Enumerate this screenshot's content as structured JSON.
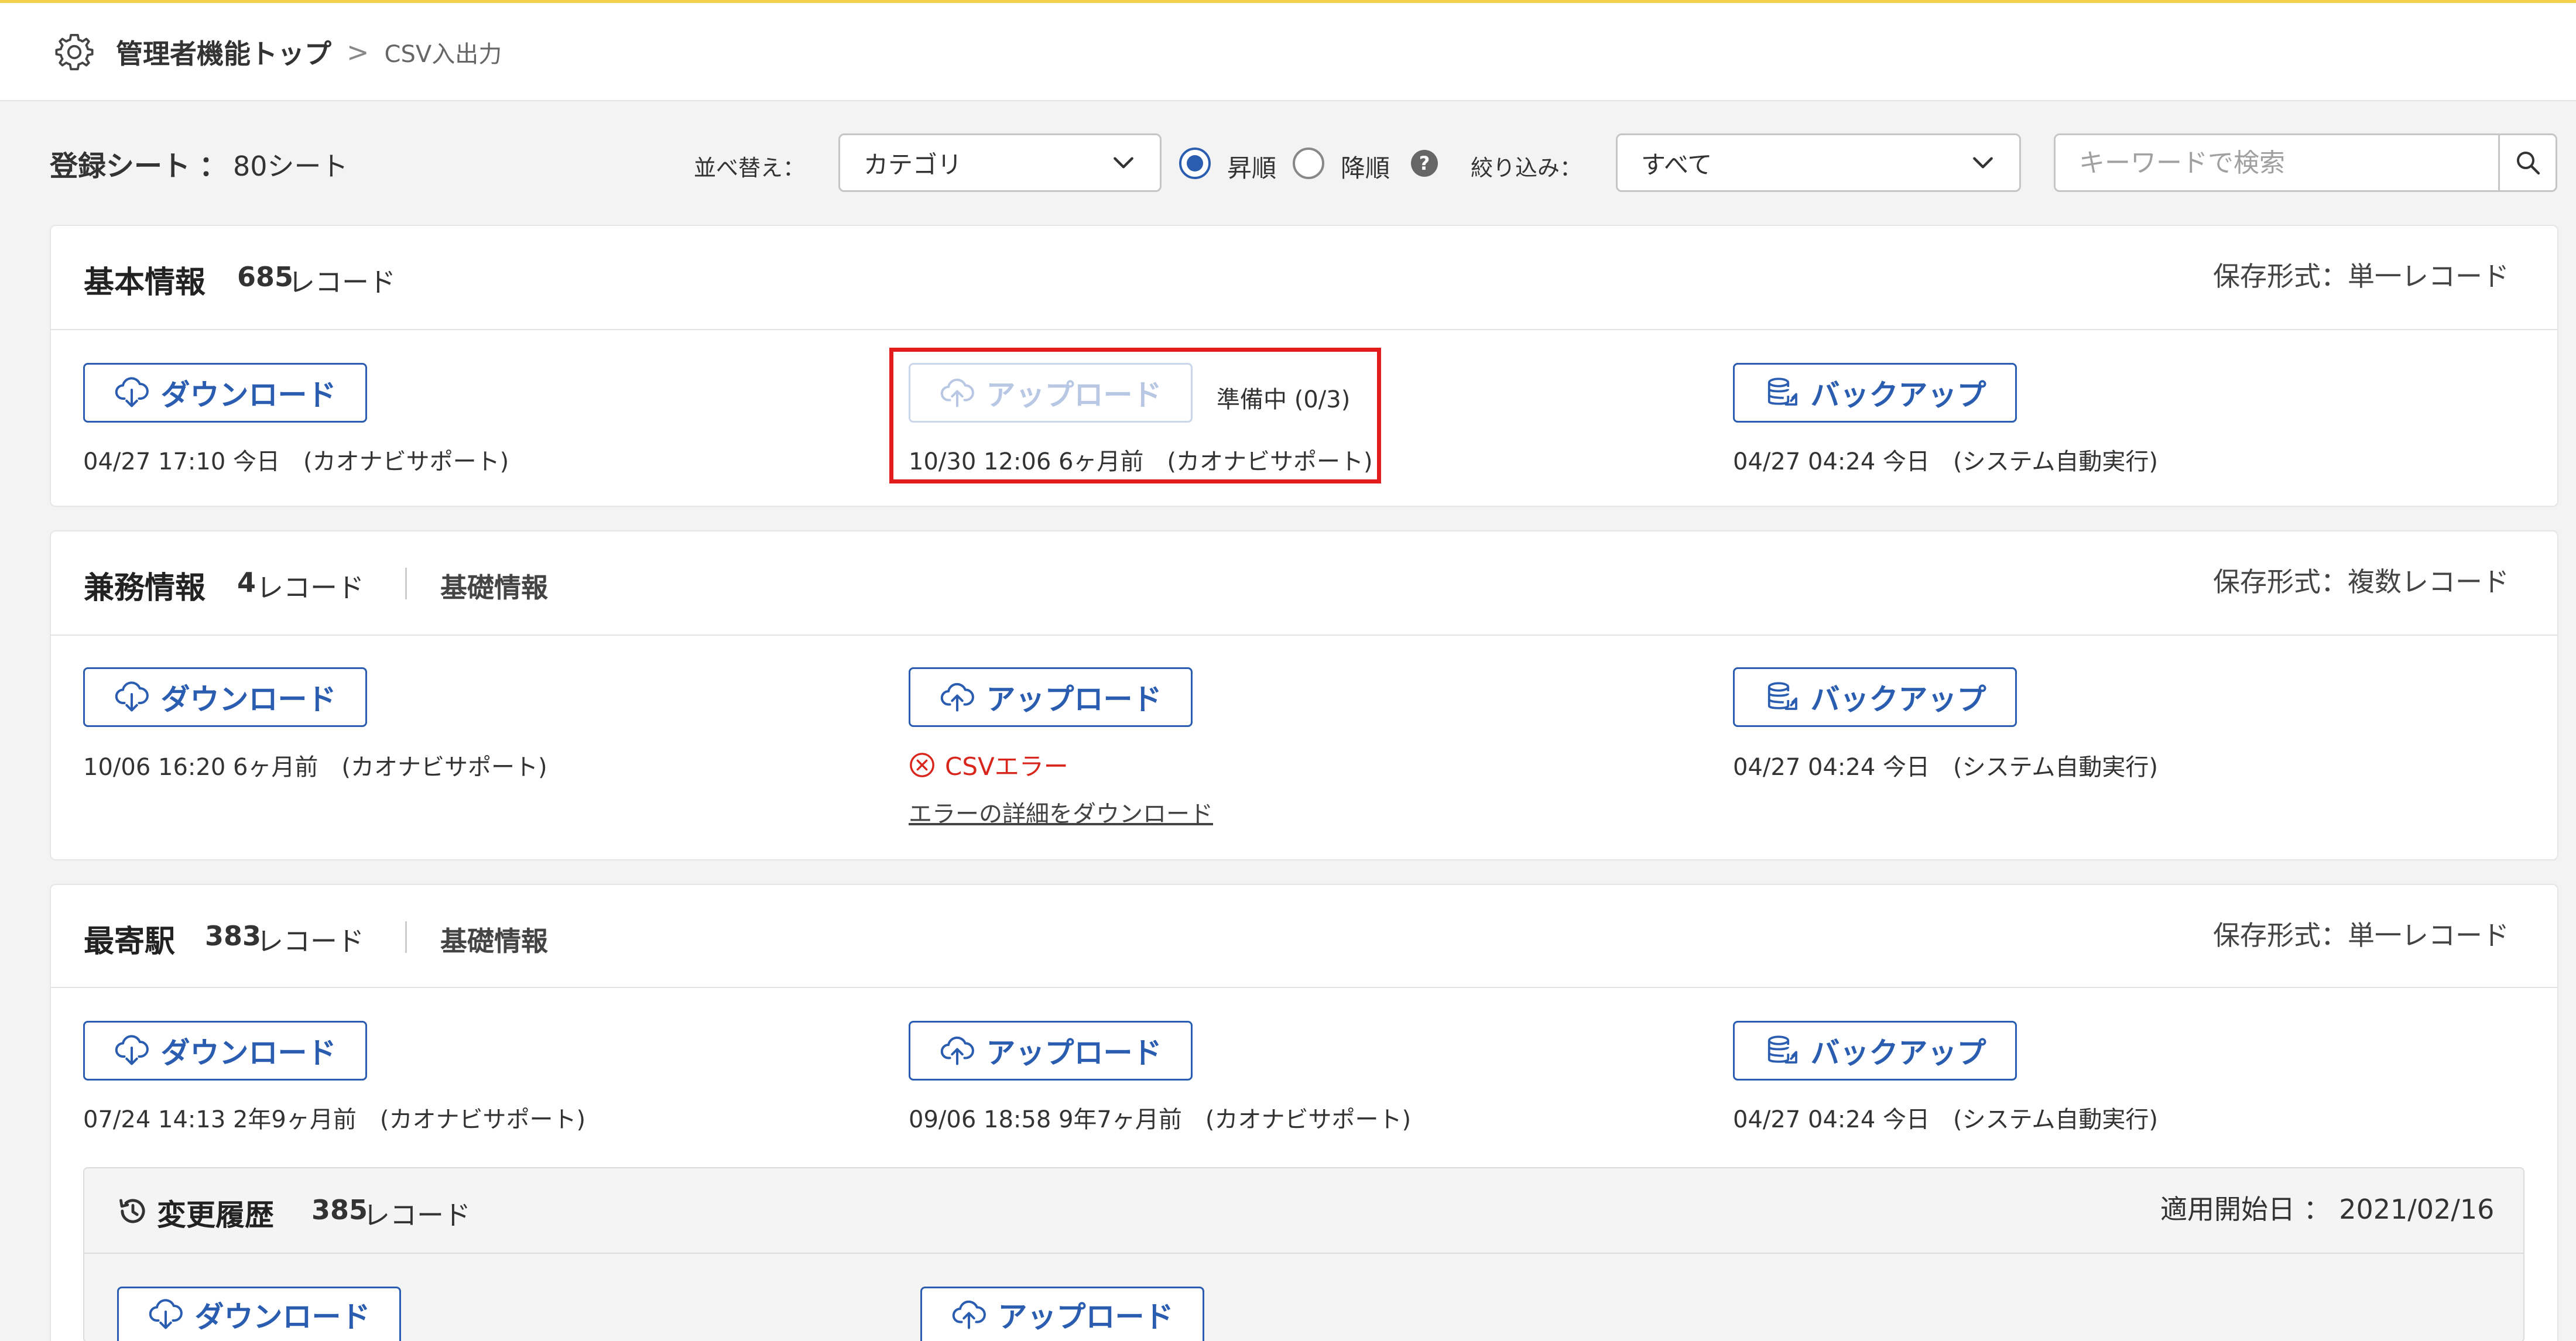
{
  "header": {
    "title": "管理者機能トップ",
    "separator": ">",
    "current": "CSV入出力",
    "icon": "gear-icon"
  },
  "toolbar": {
    "sheets_label": "登録シート",
    "sheets_colon": "：",
    "sheets_count": "80シート",
    "sort_label": "並べ替え：",
    "sort_value": "カテゴリ",
    "asc_label": "昇順",
    "desc_label": "降順",
    "help": "?",
    "filter_label": "絞り込み：",
    "filter_value": "すべて",
    "search_placeholder": "キーワードで検索"
  },
  "cards": [
    {
      "title": "基本情報",
      "count": "685",
      "unit": "レコード",
      "category": "",
      "format": "保存形式：単一レコード",
      "download": {
        "label": "ダウンロード",
        "meta": "04/27 17:10 今日　(カオナビサポート)"
      },
      "upload": {
        "label": "アップロード",
        "status": "準備中 (0/3)",
        "meta": "10/30 12:06 6ヶ月前　(カオナビサポート)",
        "disabled": true
      },
      "backup": {
        "label": "バックアップ",
        "meta": "04/27 04:24 今日　(システム自動実行)"
      }
    },
    {
      "title": "兼務情報",
      "count": "4",
      "unit": "レコード",
      "category": "基礎情報",
      "format": "保存形式：複数レコード",
      "download": {
        "label": "ダウンロード",
        "meta": "10/06 16:20 6ヶ月前　(カオナビサポート)"
      },
      "upload": {
        "label": "アップロード",
        "error": "CSVエラー",
        "error_link": "エラーの詳細をダウンロード"
      },
      "backup": {
        "label": "バックアップ",
        "meta": "04/27 04:24 今日　(システム自動実行)"
      }
    },
    {
      "title": "最寄駅",
      "count": "383",
      "unit": "レコード",
      "category": "基礎情報",
      "format": "保存形式：単一レコード",
      "download": {
        "label": "ダウンロード",
        "meta": "07/24 14:13 2年9ヶ月前　(カオナビサポート)"
      },
      "upload": {
        "label": "アップロード",
        "meta": "09/06 18:58 9年7ヶ月前　(カオナビサポート)"
      },
      "backup": {
        "label": "バックアップ",
        "meta": "04/27 04:24 今日　(システム自動実行)"
      },
      "history": {
        "title": "変更履歴",
        "count": "385",
        "unit": "レコード",
        "start_label": "適用開始日 ： 2021/02/16",
        "download_label": "ダウンロード",
        "upload_label": "アップロード"
      }
    }
  ],
  "colors": {
    "accent": "#2a5db0",
    "highlight": "#e21b1b",
    "error": "#d9261c",
    "topbar": "#f2d04a"
  }
}
